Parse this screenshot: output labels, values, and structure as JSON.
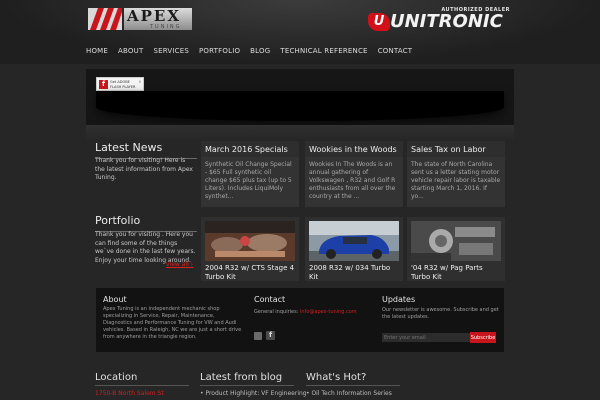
{
  "logo": {
    "name": "APEX",
    "sub": "TUNING"
  },
  "dealer": {
    "tagline": "AUTHORIZED DEALER",
    "name": "UNITRONIC",
    "badge": "U"
  },
  "nav": [
    "HOME",
    "ABOUT",
    "SERVICES",
    "PORTFOLIO",
    "BLOG",
    "TECHNICAL REFERENCE",
    "CONTACT"
  ],
  "slider": {
    "plugin_text_1": "Get ADOBE",
    "plugin_text_2": "FLASH PLAYER",
    "plugin_close": "x"
  },
  "latest_news": {
    "title": "Latest News",
    "text": "Thank you for visiting! Here is the latest information from Apex Tuning."
  },
  "news": [
    {
      "title": "March 2016 Specials",
      "text": "Synthetic Oil Change Special - $65 Full synthetic oil change $65 plus tax (up to 5 Liters). Includes LiquiMoly synthet..."
    },
    {
      "title": "Wookies in the Woods",
      "text": "Wookies In The Woods is an annual gathering of Volkswagen , R32 and Golf R enthusiasts from all over the country at the ..."
    },
    {
      "title": "Sales Tax on Labor",
      "text": "The state of North Carolina sent us a letter stating motor vehicle repair labor is taxable starting March 1, 2016. If yo..."
    }
  ],
  "portfolio": {
    "title": "Portfolio",
    "text": "Thank you for visiting . Here you can find some of the things we`ve done in the last few years. Enjoy your time looking around.",
    "view_all": "view all ›"
  },
  "portfolio_items": [
    {
      "title": "2004 R32 w/ CTS Stage 4 Turbo Kit"
    },
    {
      "title": "2008 R32 w/ 034 Turbo Kit"
    },
    {
      "title": "'04 R32 w/ Pag Parts Turbo Kit"
    }
  ],
  "footer": {
    "about_title": "About",
    "about_text": "Apex Tuning is an independent mechanic shop specializing in Service, Repair, Maintenance, Diagnostics and Performance Tuning for VW and Audi vehicles.  Based in Raleigh, NC we are just a short drive from anywhere in the triangle region.",
    "contact_title": "Contact",
    "contact_label": "General inquiries:",
    "contact_email": "info@apex-tuning.com",
    "updates_title": "Updates",
    "updates_text": "Our newsletter is awesome. Subscribe and get the latest updates.",
    "email_placeholder": "Enter your email",
    "subscribe_label": "Subscribe",
    "social_1": "rss-icon",
    "social_2": "facebook-icon",
    "facebook_glyph": "f"
  },
  "bottom": {
    "location_title": "Location",
    "location_text": "1750-B North Salem St",
    "blog_title": "Latest from blog",
    "blog_item": "• Product Highlight: VF Engineering",
    "hot_title": "What's Hot?",
    "hot_item": "• Oil Tech Information Series"
  },
  "colors": {
    "accent": "#c8141b",
    "background": "#262626",
    "panel": "#333333"
  }
}
